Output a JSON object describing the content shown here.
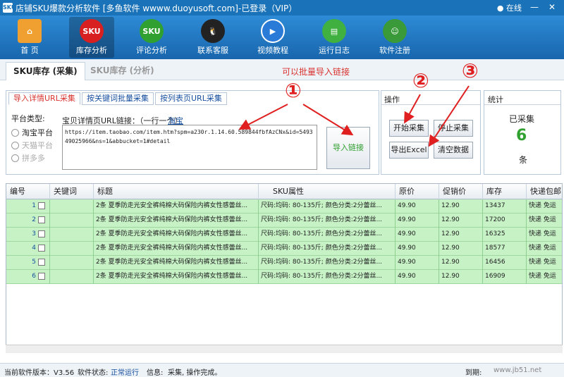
{
  "window": {
    "title": "店铺SKU爆款分析软件 [多鱼软件 wwww.duoyusoft.com]-已登录（VIP）",
    "app_icon": "SKU",
    "online": "在线"
  },
  "toolbar": {
    "items": [
      {
        "label": "首  页",
        "icon": "house-icon"
      },
      {
        "label": "库存分析",
        "icon": "sku-red-icon",
        "glyph": "SKU"
      },
      {
        "label": "评论分析",
        "icon": "sku-green-icon",
        "glyph": "SKU"
      },
      {
        "label": "联系客服",
        "icon": "qq-penguin-icon"
      },
      {
        "label": "视频教程",
        "icon": "play-icon"
      },
      {
        "label": "运行日志",
        "icon": "clipboard-icon"
      },
      {
        "label": "软件注册",
        "icon": "user-icon"
      }
    ]
  },
  "tabs": {
    "main": [
      "SKU库存 (采集)",
      "SKU库存 (分析)"
    ],
    "hint": "可以批量导入链接"
  },
  "collect": {
    "subtabs": [
      "导入详情URL采集",
      "按关键词批量采集",
      "按列表页URL采集"
    ],
    "platform_label": "平台类型:",
    "platforms": [
      "淘宝平台",
      "天猫平台",
      "拼多多"
    ],
    "url_label": "宝贝详情页URL链接：（一行一个）",
    "taobao_link": "淘宝",
    "url_value": "https://item.taobao.com/item.htm?spm=a230r.1.14.60.589844fbfAzCNx&id=549349025966&ns=1&abbucket=1#detail",
    "import_button": "导入链接"
  },
  "operation": {
    "title": "操作",
    "start": "开始采集",
    "stop": "停止采集",
    "export": "导出Excel",
    "clear": "清空数据"
  },
  "stats": {
    "title": "统计",
    "label": "已采集",
    "count": "6",
    "unit": "条"
  },
  "table": {
    "headers": [
      "编号",
      "关键词",
      "标题",
      "SKU属性",
      "原价",
      "促销价",
      "库存",
      "快递包邮"
    ],
    "rows": [
      {
        "id": "1",
        "keyword": "",
        "title": "2条 夏季防走光安全裤纯棉大码保险内裤女性感蕾丝...",
        "sku": "尺码:均码: 80-135斤; 颜色分类:2分蕾丝...",
        "price": "49.90",
        "promo": "12.90",
        "stock": "13437",
        "ship": "快递 免运"
      },
      {
        "id": "2",
        "keyword": "",
        "title": "2条 夏季防走光安全裤纯棉大码保险内裤女性感蕾丝...",
        "sku": "尺码:均码: 80-135斤; 颜色分类:2分蕾丝...",
        "price": "49.90",
        "promo": "12.90",
        "stock": "17200",
        "ship": "快递 免运"
      },
      {
        "id": "3",
        "keyword": "",
        "title": "2条 夏季防走光安全裤纯棉大码保险内裤女性感蕾丝...",
        "sku": "尺码:均码: 80-135斤; 颜色分类:2分蕾丝...",
        "price": "49.90",
        "promo": "12.90",
        "stock": "16325",
        "ship": "快递 免运"
      },
      {
        "id": "4",
        "keyword": "",
        "title": "2条 夏季防走光安全裤纯棉大码保险内裤女性感蕾丝...",
        "sku": "尺码:均码: 80-135斤; 颜色分类:2分蕾丝...",
        "price": "49.90",
        "promo": "12.90",
        "stock": "18577",
        "ship": "快递 免运"
      },
      {
        "id": "5",
        "keyword": "",
        "title": "2条 夏季防走光安全裤纯棉大码保险内裤女性感蕾丝...",
        "sku": "尺码:均码: 80-135斤; 颜色分类:2分蕾丝...",
        "price": "49.90",
        "promo": "12.90",
        "stock": "16456",
        "ship": "快递 免运"
      },
      {
        "id": "6",
        "keyword": "",
        "title": "2条 夏季防走光安全裤纯棉大码保险内裤女性感蕾丝...",
        "sku": "尺码:均码: 80-135斤; 颜色分类:2分蕾丝...",
        "price": "49.90",
        "promo": "12.90",
        "stock": "16909",
        "ship": "快递 免运"
      }
    ]
  },
  "statusbar": {
    "version": "当前软件版本：V3.56",
    "state_label": "软件状态:",
    "state_value": "正常运行",
    "info_label": "信息:",
    "info_value": "采集, 操作完成。",
    "expire_label": "到期:",
    "watermark": "www.jb51.net"
  },
  "annotations": [
    "①",
    "②",
    "③"
  ]
}
